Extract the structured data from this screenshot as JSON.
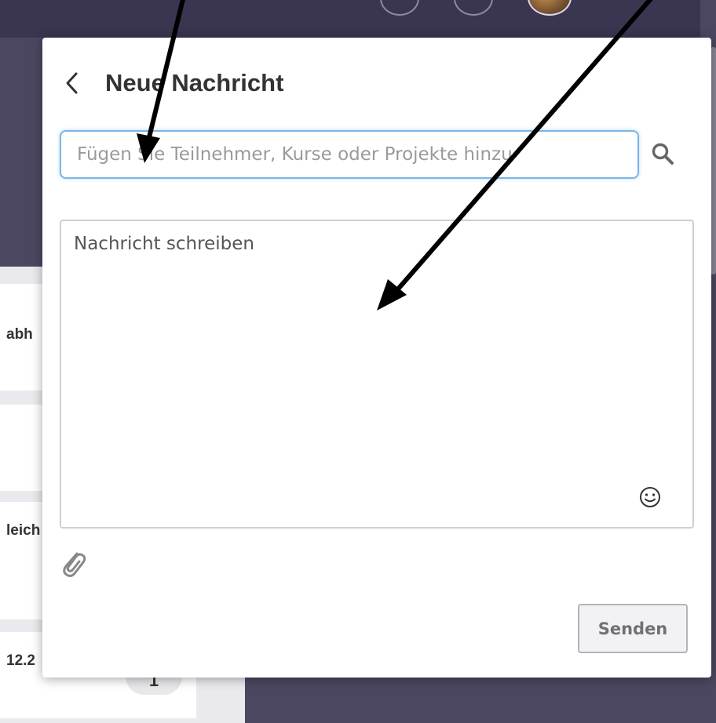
{
  "modal": {
    "title": "Neue Nachricht",
    "recipient_placeholder": "Fügen Sie Teilnehmer, Kurse oder Projekte hinzu",
    "recipient_value": "",
    "message_placeholder": "Nachricht schreiben",
    "message_value": "",
    "send_label": "Senden"
  },
  "background": {
    "snippets": [
      "abh",
      "leich",
      "12.2"
    ],
    "badge": "1"
  },
  "icons": {
    "back": "chevron-left-icon",
    "search": "search-icon",
    "emoji": "smiley-icon",
    "attach": "paperclip-icon"
  },
  "colors": {
    "header_bg": "#4c4760",
    "input_focus_border": "#7ab6e8",
    "text": "#333333"
  }
}
